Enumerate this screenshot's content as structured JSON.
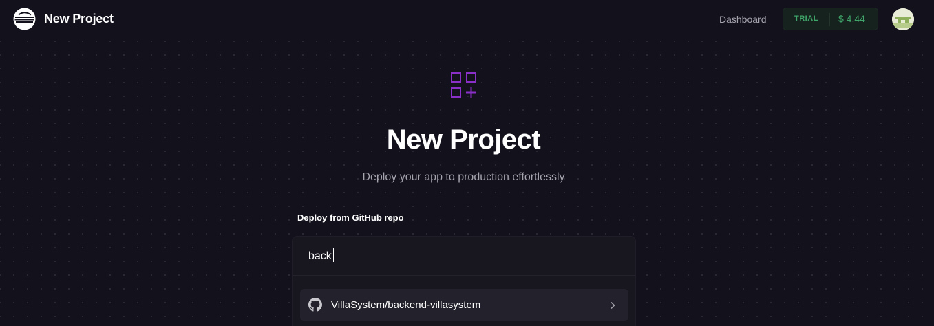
{
  "header": {
    "title": "New Project",
    "dashboard_label": "Dashboard",
    "trial_badge": "TRIAL",
    "trial_amount": "$ 4.44",
    "logo_icon": "railway-logo-icon",
    "avatar_icon": "avatar"
  },
  "hero": {
    "icon": "grid-plus-icon",
    "title": "New Project",
    "subtitle": "Deploy your app to production effortlessly"
  },
  "deploy": {
    "section_label": "Deploy from GitHub repo",
    "search_value": "back",
    "results": [
      {
        "name": "VillaSystem/backend-villasystem",
        "icon": "github-icon",
        "trailing_icon": "chevron-right-icon"
      }
    ]
  },
  "colors": {
    "background": "#13111c",
    "accent_purple": "#8b2fc9",
    "trial_green": "#3fa56a",
    "muted_text": "#a6a4ad"
  }
}
